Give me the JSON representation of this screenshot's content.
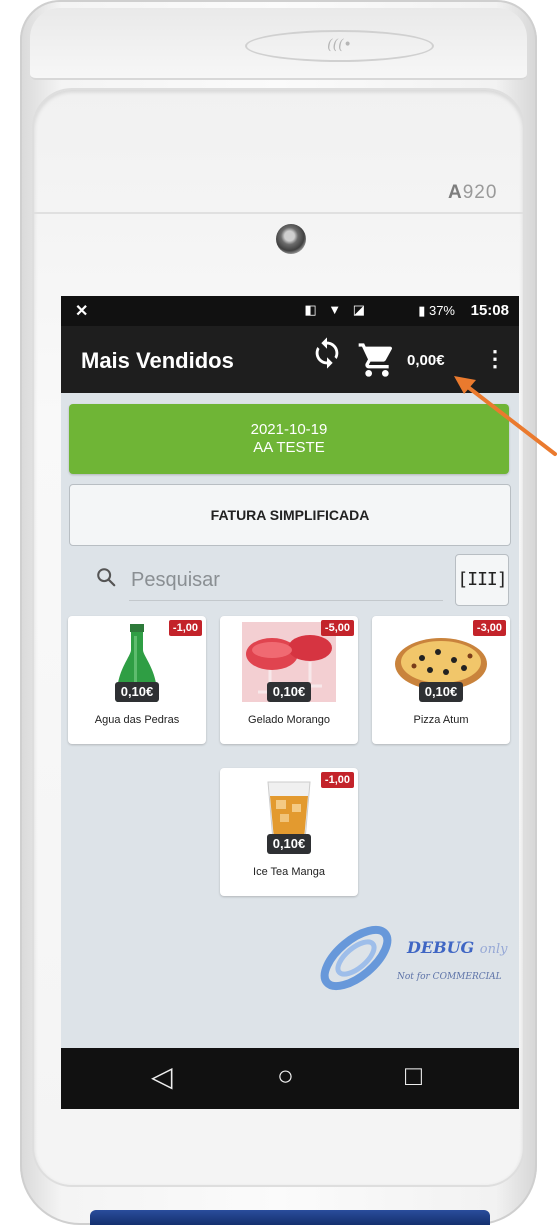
{
  "device": {
    "model_prefix": "A",
    "model_number": "920",
    "nfc_logo": "(((•"
  },
  "statusbar": {
    "left_icon": "✕",
    "icons": "◧ ▼ ◪",
    "battery": "▮ 37%",
    "time": "15:08"
  },
  "appbar": {
    "title": "Mais Vendidos",
    "sync_icon": "refresh-icon",
    "cart_icon": "cart-icon",
    "total": "0,00€",
    "more_icon": "⋮"
  },
  "banner": {
    "date": "2021-10-19",
    "name": "AA TESTE",
    "color": "#6fb536"
  },
  "document_type": "FATURA SIMPLIFICADA",
  "search": {
    "placeholder": "Pesquisar",
    "barcode_label": "[III]"
  },
  "products": [
    {
      "name": "Agua das Pedras",
      "price": "0,10€",
      "discount": "-1,00",
      "image": "green-bottle"
    },
    {
      "name": "Gelado Morango",
      "price": "0,10€",
      "discount": "-5,00",
      "image": "strawberry-dessert"
    },
    {
      "name": "Pizza Atum",
      "price": "0,10€",
      "discount": "-3,00",
      "image": "pizza"
    },
    {
      "name": "Ice Tea Manga",
      "price": "0,10€",
      "discount": "-1,00",
      "image": "iced-tea-glass"
    }
  ],
  "watermark": {
    "line1": "DEBUG",
    "line1_suffix": "only",
    "line2": "Not for COMMERCIAL"
  },
  "navbar": {
    "back": "◁",
    "home": "○",
    "recents": "□"
  },
  "colors": {
    "discount_badge": "#c3232a",
    "appbar": "#1e1e1e",
    "annotation_arrow": "#ea7a2e"
  }
}
